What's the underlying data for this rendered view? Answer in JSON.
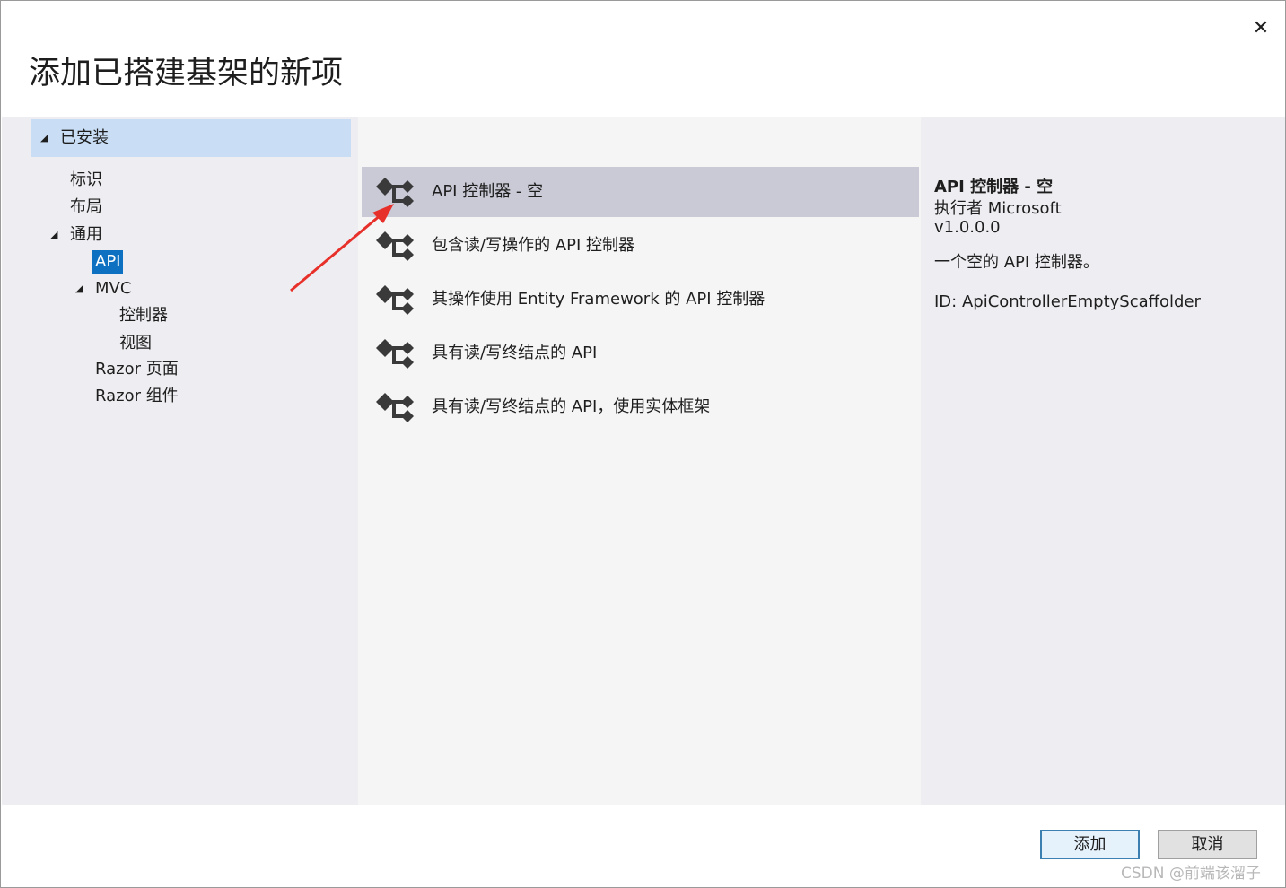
{
  "dialog": {
    "title": "添加已搭建基架的新项",
    "close_glyph": "✕"
  },
  "tree": {
    "installed": "已安装",
    "items": [
      {
        "label": "标识"
      },
      {
        "label": "布局"
      },
      {
        "label": "通用"
      },
      {
        "label": "API"
      },
      {
        "label": "MVC"
      },
      {
        "label": "控制器"
      },
      {
        "label": "视图"
      },
      {
        "label": "Razor 页面"
      },
      {
        "label": "Razor 组件"
      }
    ]
  },
  "list": {
    "items": [
      {
        "label": "API 控制器 - 空",
        "icon": "scaffold-icon"
      },
      {
        "label": "包含读/写操作的 API 控制器",
        "icon": "scaffold-icon"
      },
      {
        "label": "其操作使用 Entity Framework 的 API 控制器",
        "icon": "scaffold-icon"
      },
      {
        "label": "具有读/写终结点的 API",
        "icon": "scaffold-icon"
      },
      {
        "label": "具有读/写终结点的 API，使用实体框架",
        "icon": "scaffold-icon"
      }
    ],
    "selected_index": 0
  },
  "detail": {
    "title": "API 控制器 - 空",
    "author": "执行者 Microsoft",
    "version": "v1.0.0.0",
    "description": "一个空的 API 控制器。",
    "id": "ID: ApiControllerEmptyScaffolder"
  },
  "footer": {
    "add_label": "添加",
    "cancel_label": "取消"
  },
  "watermark": "CSDN @前端该溜子",
  "colors": {
    "selected_tree": "#0e70c0",
    "selected_list": "#c9cad6",
    "installed_header": "#c9def5",
    "annotation_arrow": "#e8302a"
  }
}
